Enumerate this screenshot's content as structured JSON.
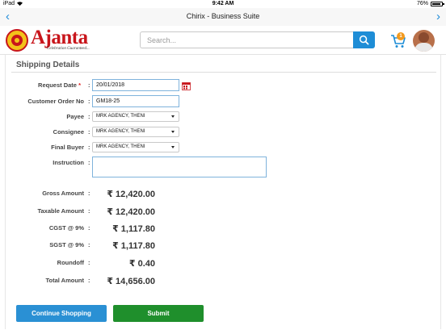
{
  "status_bar": {
    "device": "iPad",
    "time": "9:42 AM",
    "battery": "76%"
  },
  "nav": {
    "title": "Chirix - Business Suite"
  },
  "header": {
    "logo_text": "Ajanta",
    "logo_tagline": "Celebration Guaranteed...",
    "search_placeholder": "Search...",
    "cart_count": "1"
  },
  "form": {
    "title": "Shipping Details",
    "fields": [
      {
        "label": "Request Date",
        "required": "*",
        "value": "20/01/2018"
      },
      {
        "label": "Customer Order No",
        "value": "GM18-25"
      },
      {
        "label": "Payee",
        "value": "MRK AGENCY, THENI"
      },
      {
        "label": "Consignee",
        "value": "MRK AGENCY, THENI"
      },
      {
        "label": "Final Buyer",
        "value": "MRK AGENCY, THENI"
      },
      {
        "label": "Instruction",
        "value": ""
      }
    ]
  },
  "summary": [
    {
      "label": "Gross Amount",
      "value": "₹ 12,420.00"
    },
    {
      "label": "Taxable Amount",
      "value": "₹ 12,420.00"
    },
    {
      "label": "CGST @ 9%",
      "value": "₹ 1,117.80"
    },
    {
      "label": "SGST @ 9%",
      "value": "₹ 1,117.80"
    },
    {
      "label": "Roundoff",
      "value": "₹ 0.40"
    },
    {
      "label": "Total Amount",
      "value": "₹ 14,656.00"
    }
  ],
  "buttons": {
    "continue": "Continue Shopping",
    "submit": "Submit"
  },
  "colors": {
    "primary": "#1e8dd6",
    "submit": "#1f8f2c",
    "brand_red": "#c8151b",
    "badge": "#f39a1e"
  }
}
